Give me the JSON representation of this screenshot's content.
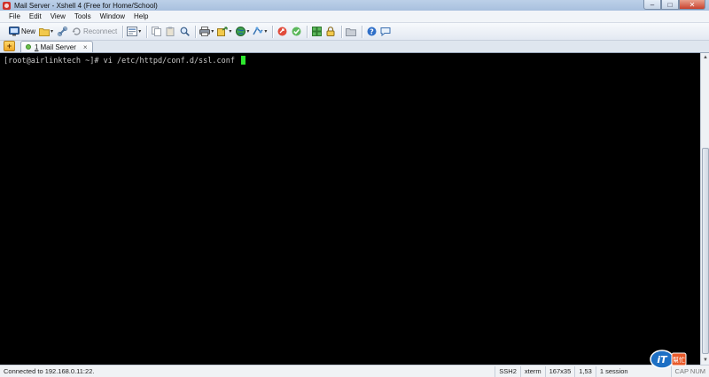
{
  "window": {
    "title": "Mail Server - Xshell 4 (Free for Home/School)",
    "controls": {
      "minimize": "–",
      "maximize": "□",
      "close": "✕"
    }
  },
  "menu": [
    "File",
    "Edit",
    "View",
    "Tools",
    "Window",
    "Help"
  ],
  "toolbar": {
    "new_label": "New",
    "reconnect_label": "Reconnect",
    "caret": "▾"
  },
  "tabs": {
    "add": "+",
    "items": [
      {
        "number": "1",
        "label": "Mail Server",
        "close": "×"
      }
    ]
  },
  "terminal": {
    "prompt": "[root@airlinktech ~]# ",
    "command": "vi /etc/httpd/conf.d/ssl.conf "
  },
  "scroll": {
    "up": "▲",
    "down": "▼"
  },
  "statusbar": {
    "connection": "Connected to 192.168.0.11:22.",
    "protocol": "SSH2",
    "terminal_type": "xterm",
    "size": "167x35",
    "cursor_pos": "1,53",
    "sessions": "1 session",
    "locks": "CAP NUM"
  },
  "watermark": {
    "text": "iT",
    "subtext": "幫忙"
  },
  "colors": {
    "terminal_bg": "#000000",
    "cursor": "#2ee82e",
    "accent": "#d0302a"
  }
}
